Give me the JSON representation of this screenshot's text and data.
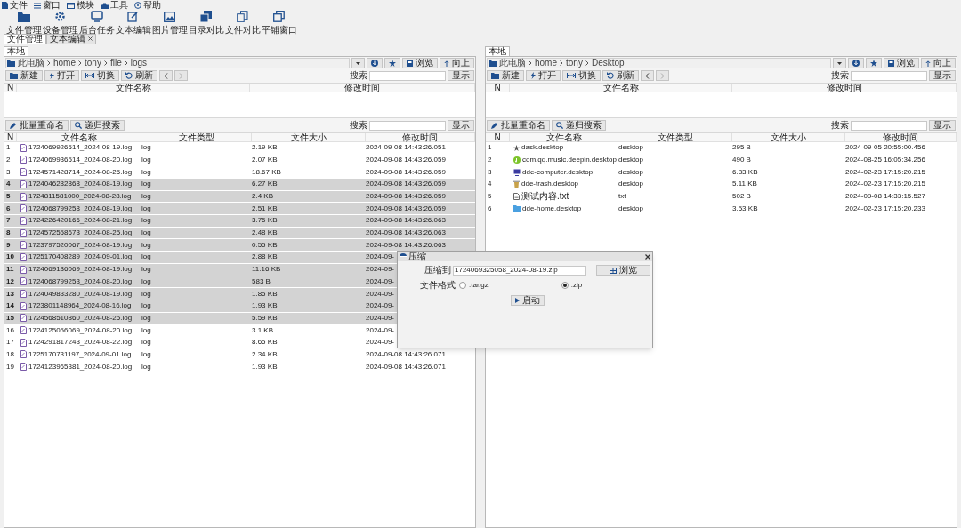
{
  "menu": [
    {
      "label": "文件"
    },
    {
      "label": "窗口"
    },
    {
      "label": "模块"
    },
    {
      "label": "工具"
    },
    {
      "label": "帮助"
    }
  ],
  "toolbar": [
    {
      "label": "文件管理"
    },
    {
      "label": "设备管理"
    },
    {
      "label": "后台任务"
    },
    {
      "label": "文本编辑"
    },
    {
      "label": "图片管理"
    },
    {
      "label": "目录对比"
    },
    {
      "label": "文件对比"
    },
    {
      "label": "平铺窗口"
    }
  ],
  "doc_tabs": [
    {
      "label": "文件管理",
      "selected": true,
      "closable": false
    },
    {
      "label": "文本编辑",
      "selected": false,
      "closable": true
    }
  ],
  "panels": [
    {
      "tab": "本地",
      "path": [
        "此电脑",
        "home",
        "tony",
        "file",
        "logs"
      ],
      "path_buttons": [
        "浏览",
        "向上"
      ],
      "actions": [
        "新建",
        "打开",
        "切换",
        "刷新"
      ],
      "search_label": "搜索",
      "show_button": "显示",
      "upper_columns": [
        "N",
        "文件名称",
        "修改时间"
      ],
      "lower_actions": [
        "批量重命名",
        "递归搜索"
      ],
      "lower_search_label": "搜索",
      "lower_show_button": "显示",
      "columns": [
        "N",
        "文件名称",
        "文件类型",
        "文件大小",
        "修改时间"
      ],
      "rows": [
        {
          "n": "1",
          "name": "1724069926514_2024-08-19.log",
          "type": "log",
          "size": "2.19 KB",
          "time": "2024-09-08 14:43:26.051",
          "selected": false
        },
        {
          "n": "2",
          "name": "1724069936514_2024-08-20.log",
          "type": "log",
          "size": "2.07 KB",
          "time": "2024-09-08 14:43:26.059",
          "selected": false
        },
        {
          "n": "3",
          "name": "1724571428714_2024-08-25.log",
          "type": "log",
          "size": "18.67 KB",
          "time": "2024-09-08 14:43:26.059",
          "selected": false
        },
        {
          "n": "4",
          "name": "1724046282868_2024-08-19.log",
          "type": "log",
          "size": "6.27 KB",
          "time": "2024-09-08 14:43:26.059",
          "selected": true
        },
        {
          "n": "5",
          "name": "1724811581000_2024-08-28.log",
          "type": "log",
          "size": "2.4 KB",
          "time": "2024-09-08 14:43:26.059",
          "selected": true
        },
        {
          "n": "6",
          "name": "1724068799258_2024-08-19.log",
          "type": "log",
          "size": "2.51 KB",
          "time": "2024-09-08 14:43:26.059",
          "selected": true
        },
        {
          "n": "7",
          "name": "1724226420166_2024-08-21.log",
          "type": "log",
          "size": "3.75 KB",
          "time": "2024-09-08 14:43:26.063",
          "selected": true
        },
        {
          "n": "8",
          "name": "1724572558673_2024-08-25.log",
          "type": "log",
          "size": "2.48 KB",
          "time": "2024-09-08 14:43:26.063",
          "selected": true
        },
        {
          "n": "9",
          "name": "1723797520067_2024-08-19.log",
          "type": "log",
          "size": "0.55 KB",
          "time": "2024-09-08 14:43:26.063",
          "selected": true
        },
        {
          "n": "10",
          "name": "1725170408289_2024-09-01.log",
          "type": "log",
          "size": "2.88 KB",
          "time": "2024-09-",
          "selected": true
        },
        {
          "n": "11",
          "name": "1724069136069_2024-08-19.log",
          "type": "log",
          "size": "11.16 KB",
          "time": "2024-09-",
          "selected": true
        },
        {
          "n": "12",
          "name": "1724068799253_2024-08-20.log",
          "type": "log",
          "size": "583 B",
          "time": "2024-09-",
          "selected": true
        },
        {
          "n": "13",
          "name": "1724049833280_2024-08-19.log",
          "type": "log",
          "size": "1.85 KB",
          "time": "2024-09-",
          "selected": true
        },
        {
          "n": "14",
          "name": "1723801148964_2024-08-16.log",
          "type": "log",
          "size": "1.93 KB",
          "time": "2024-09-",
          "selected": true
        },
        {
          "n": "15",
          "name": "1724568510860_2024-08-25.log",
          "type": "log",
          "size": "5.59 KB",
          "time": "2024-09-",
          "selected": true
        },
        {
          "n": "16",
          "name": "1724125056069_2024-08-20.log",
          "type": "log",
          "size": "3.1 KB",
          "time": "2024-09-",
          "selected": false
        },
        {
          "n": "17",
          "name": "1724291817243_2024-08-22.log",
          "type": "log",
          "size": "8.65 KB",
          "time": "2024-09-",
          "selected": false
        },
        {
          "n": "18",
          "name": "1725170731197_2024-09-01.log",
          "type": "log",
          "size": "2.34 KB",
          "time": "2024-09-08 14:43:26.071",
          "selected": false
        },
        {
          "n": "19",
          "name": "1724123965381_2024-08-20.log",
          "type": "log",
          "size": "1.93 KB",
          "time": "2024-09-08 14:43:26.071",
          "selected": false
        }
      ]
    },
    {
      "tab": "本地",
      "path": [
        "此电脑",
        "home",
        "tony",
        "Desktop"
      ],
      "path_buttons": [
        "浏览",
        "向上"
      ],
      "actions": [
        "新建",
        "打开",
        "切换",
        "刷新"
      ],
      "search_label": "搜索",
      "show_button": "显示",
      "upper_columns": [
        "N",
        "文件名称",
        "修改时间"
      ],
      "lower_actions": [
        "批量重命名",
        "递归搜索"
      ],
      "lower_search_label": "搜索",
      "lower_show_button": "显示",
      "columns": [
        "N",
        "文件名称",
        "文件类型",
        "文件大小",
        "修改时间"
      ],
      "rows": [
        {
          "n": "1",
          "name": "dask.desktop",
          "type": "desktop",
          "size": "295 B",
          "time": "2024-09-05 20:55:00.456",
          "selected": false
        },
        {
          "n": "2",
          "name": "com.qq.music.deepin.desktop",
          "type": "desktop",
          "size": "490 B",
          "time": "2024-08-25 16:05:34.256",
          "selected": false
        },
        {
          "n": "3",
          "name": "dde-computer.desktop",
          "type": "desktop",
          "size": "6.83 KB",
          "time": "2024-02-23 17:15:20.215",
          "selected": false
        },
        {
          "n": "4",
          "name": "dde-trash.desktop",
          "type": "desktop",
          "size": "5.11 KB",
          "time": "2024-02-23 17:15:20.215",
          "selected": false
        },
        {
          "n": "5",
          "name": "测试内容.txt",
          "type": "txt",
          "size": "502 B",
          "time": "2024-09-08 14:33:15.527",
          "selected": false
        },
        {
          "n": "6",
          "name": "dde-home.desktop",
          "type": "desktop",
          "size": "3.53 KB",
          "time": "2024-02-23 17:15:20.233",
          "selected": false
        }
      ]
    }
  ],
  "dialog": {
    "title": "压缩",
    "target_label": "压缩到",
    "target_value": "1724069325058_2024-08-19.zip",
    "browse_button": "浏览",
    "format_label": "文件格式",
    "formats": [
      {
        "label": ".tar.gz",
        "selected": false
      },
      {
        "label": ".zip",
        "selected": true
      }
    ],
    "start_button": "启动"
  }
}
